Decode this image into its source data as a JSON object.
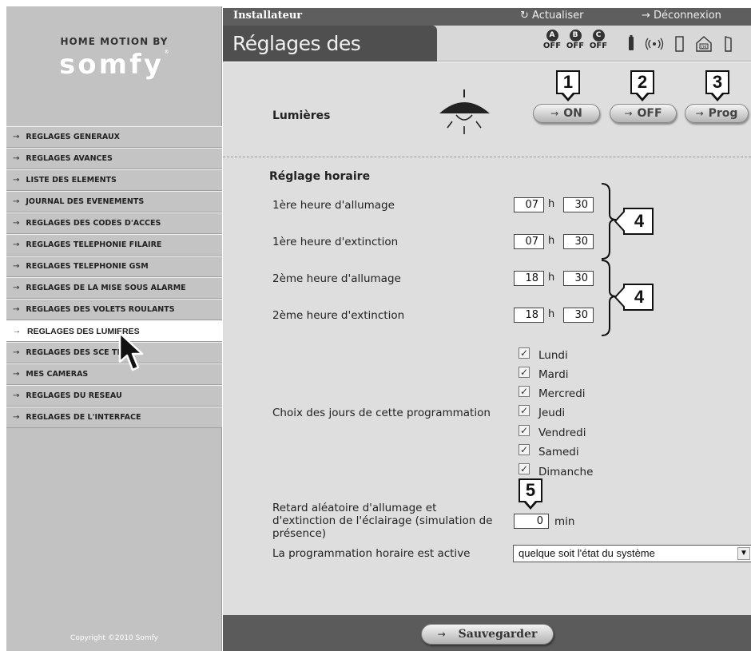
{
  "sidebar": {
    "brand_top": "HOME MOTION BY",
    "brand_logo": "somfy",
    "brand_logo_mark": "®",
    "menu_arrow": "→",
    "items": [
      {
        "label": "REGLAGES GENERAUX"
      },
      {
        "label": "REGLAGES AVANCES"
      },
      {
        "label": "LISTE DES ELEMENTS"
      },
      {
        "label": "JOURNAL DES EVENEMENTS"
      },
      {
        "label": "REGLAGES DES CODES D'ACCES"
      },
      {
        "label": "REGLAGES TELEPHONIE FILAIRE"
      },
      {
        "label": "REGLAGES TELEPHONIE GSM"
      },
      {
        "label": "REGLAGES DE LA MISE SOUS ALARME"
      },
      {
        "label": "REGLAGES DES VOLETS ROULANTS"
      },
      {
        "label": "REGLAGES DES LUMIERES"
      },
      {
        "label": "REGLAGES DES SCE TI"
      },
      {
        "label": "MES CAMERAS"
      },
      {
        "label": "REGLAGES DU RESEAU"
      },
      {
        "label": "REGLAGES DE L'INTERFACE"
      }
    ],
    "active_index": 9,
    "copyright": "Copyright ©2010 Somfy"
  },
  "header": {
    "role": "Installateur",
    "refresh_label": "Actualiser",
    "refresh_icon": "↻",
    "logout_label": "Déconnexion",
    "logout_icon": "→",
    "page_title": "Réglages des lumières",
    "zones": [
      {
        "letter": "A",
        "state": "OFF"
      },
      {
        "letter": "B",
        "state": "OFF"
      },
      {
        "letter": "C",
        "state": "OFF"
      }
    ],
    "status_icons": [
      "battery-icon",
      "radio-signal-icon",
      "door-icon",
      "home-ok-icon",
      "door-open-icon"
    ]
  },
  "lights": {
    "label": "Lumières",
    "on_label": "ON",
    "off_label": "OFF",
    "prog_label": "Prog",
    "arrow": "→"
  },
  "callouts": {
    "on": "1",
    "off": "2",
    "prog": "3",
    "schedule1": "4",
    "schedule2": "4",
    "delay": "5"
  },
  "schedule": {
    "title": "Réglage horaire",
    "h_sep": "h",
    "rows": [
      {
        "label": "1ère heure d'allumage",
        "hour": "07",
        "minute": "30"
      },
      {
        "label": "1ère heure d'extinction",
        "hour": "07",
        "minute": "30"
      },
      {
        "label": "2ème heure d'allumage",
        "hour": "18",
        "minute": "30"
      },
      {
        "label": "2ème heure d'extinction",
        "hour": "18",
        "minute": "30"
      }
    ]
  },
  "days": {
    "label": "Choix des jours de cette programmation",
    "check_mark": "✓",
    "items": [
      {
        "label": "Lundi",
        "checked": true
      },
      {
        "label": "Mardi",
        "checked": true
      },
      {
        "label": "Mercredi",
        "checked": true
      },
      {
        "label": "Jeudi",
        "checked": true
      },
      {
        "label": "Vendredi",
        "checked": true
      },
      {
        "label": "Samedi",
        "checked": true
      },
      {
        "label": "Dimanche",
        "checked": true
      }
    ]
  },
  "random_delay": {
    "line1": "Retard aléatoire d'allumage et",
    "line2": "d'extinction de l'éclairage (simulation de",
    "line3": "présence)",
    "value": "0",
    "unit": "min"
  },
  "activation": {
    "label": "La programmation horaire est active",
    "selected": "quelque soit l'état du système"
  },
  "footer": {
    "save_label": "Sauvegarder",
    "arrow": "→"
  }
}
